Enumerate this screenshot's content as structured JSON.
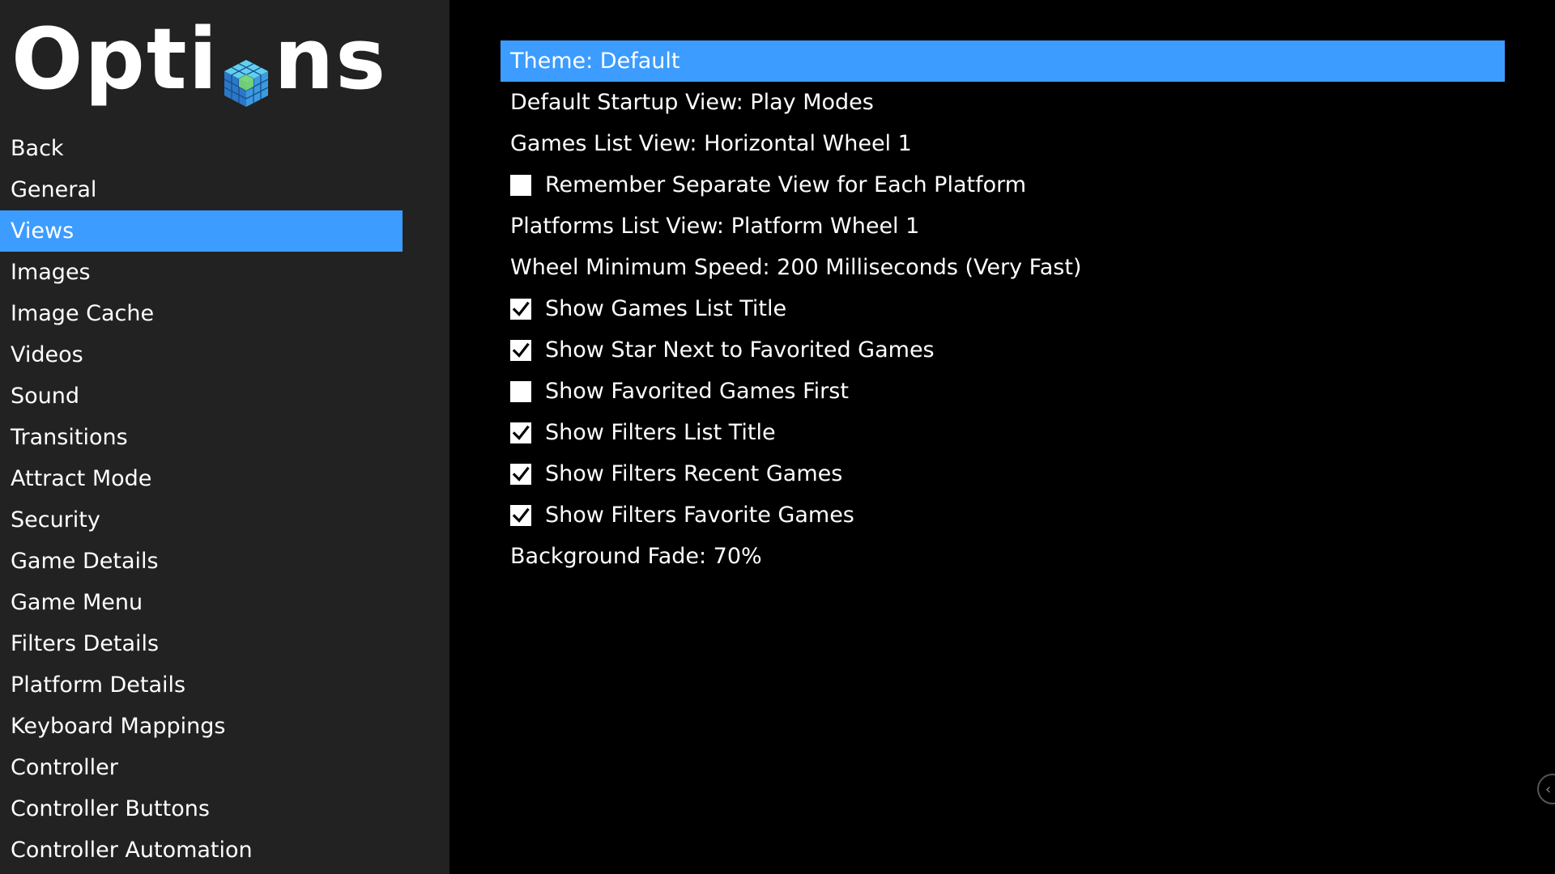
{
  "logo": {
    "text_start": "Opti",
    "text_end": "ns",
    "icon": "cube-logo-icon"
  },
  "colors": {
    "sidebar_bg": "#222222",
    "main_bg": "#000000",
    "accent": "#3c9cff",
    "text": "#ffffff"
  },
  "sidebar": {
    "items": [
      {
        "label": "Back"
      },
      {
        "label": "General"
      },
      {
        "label": "Views",
        "active": true
      },
      {
        "label": "Images"
      },
      {
        "label": "Image Cache"
      },
      {
        "label": "Videos"
      },
      {
        "label": "Sound"
      },
      {
        "label": "Transitions"
      },
      {
        "label": "Attract Mode"
      },
      {
        "label": "Security"
      },
      {
        "label": "Game Details"
      },
      {
        "label": "Game Menu"
      },
      {
        "label": "Filters Details"
      },
      {
        "label": "Platform Details"
      },
      {
        "label": "Keyboard Mappings"
      },
      {
        "label": "Controller"
      },
      {
        "label": "Controller Buttons"
      },
      {
        "label": "Controller Automation"
      }
    ]
  },
  "main": {
    "options": [
      {
        "label": "Theme: Default",
        "selected": true
      },
      {
        "label": "Default Startup View: Play Modes"
      },
      {
        "label": "Games List View: Horizontal Wheel 1"
      },
      {
        "label": "Remember Separate View for Each Platform",
        "checkbox": true,
        "checked": false
      },
      {
        "label": "Platforms List View: Platform Wheel 1"
      },
      {
        "label": "Wheel Minimum Speed: 200 Milliseconds (Very Fast)"
      },
      {
        "label": "Show Games List Title",
        "checkbox": true,
        "checked": true
      },
      {
        "label": "Show Star Next to Favorited Games",
        "checkbox": true,
        "checked": true
      },
      {
        "label": "Show Favorited Games First",
        "checkbox": true,
        "checked": false
      },
      {
        "label": "Show Filters List Title",
        "checkbox": true,
        "checked": true
      },
      {
        "label": "Show Filters Recent Games",
        "checkbox": true,
        "checked": true
      },
      {
        "label": "Show Filters Favorite Games",
        "checkbox": true,
        "checked": true
      },
      {
        "label": "Background Fade: 70%"
      }
    ]
  },
  "scroll_handle": {
    "icon": "chevron-left-icon",
    "glyph": "‹"
  }
}
